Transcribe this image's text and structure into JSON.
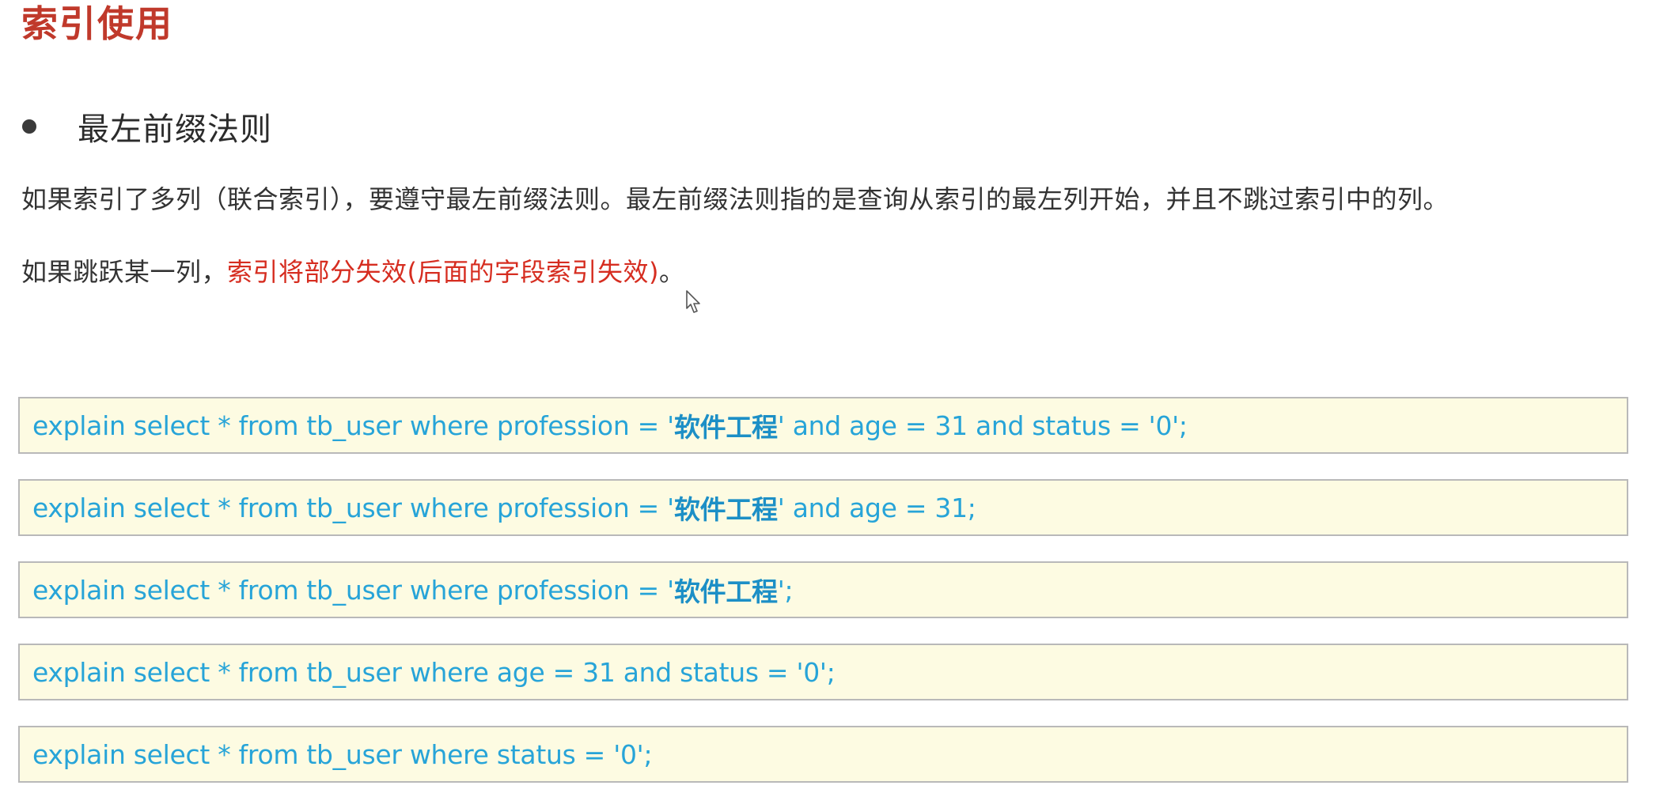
{
  "title": "索引使用",
  "bullet": "最左前缀法则",
  "paragraph1": "如果索引了多列（联合索引），要遵守最左前缀法则。最左前缀法则指的是查询从索引的最左列开始，并且不跳过索引中的列。",
  "paragraph2": {
    "prefix": "如果跳跃某一列，",
    "highlight": "索引将部分失效(后面的字段索引失效)",
    "suffix": "。"
  },
  "code_lines": [
    {
      "before": "explain select * from tb_user where profession = '",
      "strong": "软件工程",
      "after": "' and age = 31 and status = '0';"
    },
    {
      "before": "explain select * from tb_user where profession = '",
      "strong": "软件工程",
      "after": "' and age = 31;"
    },
    {
      "before": "explain select * from tb_user where profession = '",
      "strong": "软件工程",
      "after": "';"
    },
    {
      "before": "explain select * from tb_user where age = 31 and status = '0';",
      "strong": "",
      "after": ""
    },
    {
      "before": "explain select * from tb_user where status = '0';",
      "strong": "",
      "after": ""
    }
  ],
  "colors": {
    "title": "#c0392b",
    "highlight": "#d62d20",
    "code_text": "#27a4d8",
    "code_bg": "#fdfbe2"
  },
  "icons": [
    "mouse-cursor-icon",
    "bullet-dot-icon"
  ]
}
